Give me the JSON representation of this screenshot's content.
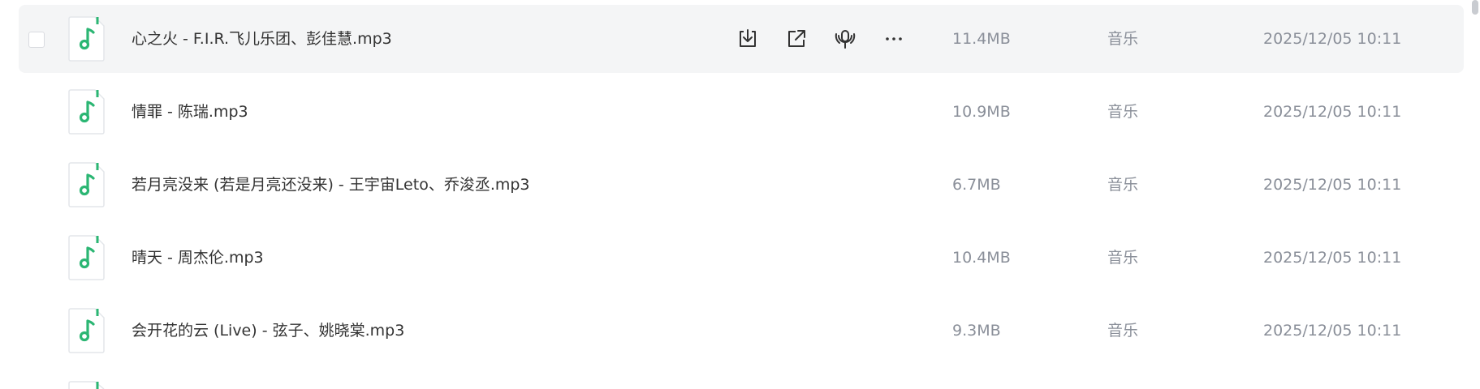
{
  "files": [
    {
      "name": "心之火 - F.I.R.飞儿乐团、彭佳慧.mp3",
      "size": "11.4MB",
      "type": "音乐",
      "date": "2025/12/05 10:11"
    },
    {
      "name": "情罪 - 陈瑞.mp3",
      "size": "10.9MB",
      "type": "音乐",
      "date": "2025/12/05 10:11"
    },
    {
      "name": "若月亮没来 (若是月亮还没来) - 王宇宙Leto、乔浚丞.mp3",
      "size": "6.7MB",
      "type": "音乐",
      "date": "2025/12/05 10:11"
    },
    {
      "name": "晴天 - 周杰伦.mp3",
      "size": "10.4MB",
      "type": "音乐",
      "date": "2025/12/05 10:11"
    },
    {
      "name": "会开花的云 (Live) - 弦子、姚晓棠.mp3",
      "size": "9.3MB",
      "type": "音乐",
      "date": "2025/12/05 10:11"
    }
  ],
  "hovered_row_actions": [
    "download-icon",
    "share-icon",
    "podcast-icon",
    "more-icon"
  ],
  "colors": {
    "accent": "#2bb673",
    "hover_bg": "#f4f5f6",
    "meta_text": "#8a8f99"
  }
}
